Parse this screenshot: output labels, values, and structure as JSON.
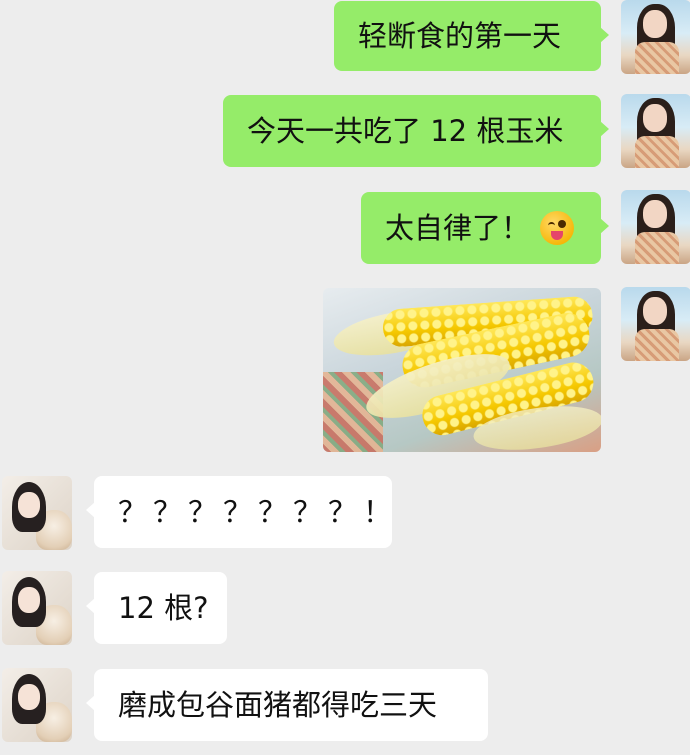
{
  "messages": [
    {
      "side": "me",
      "text": "轻断食的第一天"
    },
    {
      "side": "me",
      "text": "今天一共吃了 12 根玉米"
    },
    {
      "side": "me",
      "text": "太自律了！",
      "emoji": "winking-tongue-emoji"
    },
    {
      "side": "me",
      "type": "image",
      "image_subject": "corn-cobs-photo"
    },
    {
      "side": "other",
      "text": "？？？？？？？！"
    },
    {
      "side": "other",
      "text": "12 根?"
    },
    {
      "side": "other",
      "text": "磨成包谷面猪都得吃三天"
    }
  ],
  "colors": {
    "background": "#ededed",
    "my_bubble": "#95ec69",
    "other_bubble": "#ffffff"
  }
}
